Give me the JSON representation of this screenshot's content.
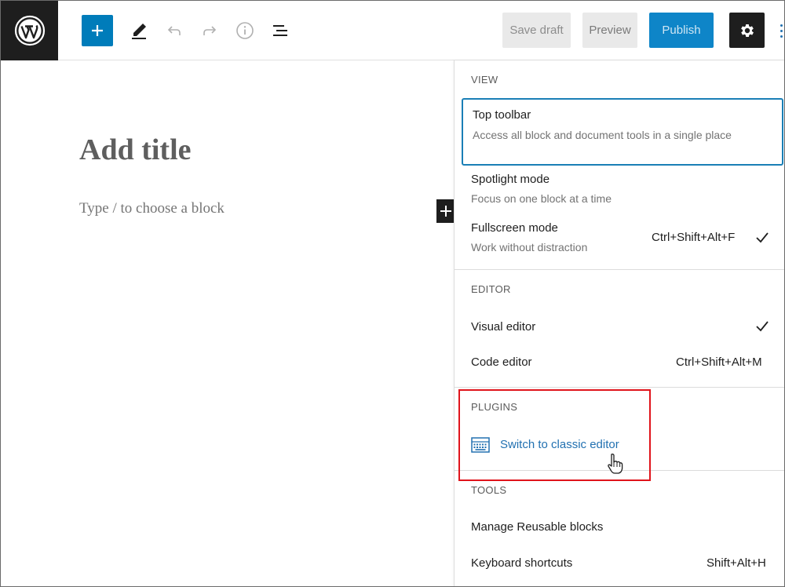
{
  "header": {
    "save_draft_label": "Save draft",
    "preview_label": "Preview",
    "publish_label": "Publish"
  },
  "icons": {
    "wordpress": "wordpress-logo-icon",
    "add": "plus-icon",
    "edit": "pencil-icon",
    "undo": "undo-icon",
    "redo": "redo-icon",
    "info": "info-icon",
    "outline": "list-view-icon",
    "settings": "gear-icon",
    "more": "vertical-ellipsis-icon",
    "plugin": "keyboard-icon",
    "cursor": "hand-pointer-icon",
    "check": "check-icon"
  },
  "editor": {
    "title_placeholder": "Add title",
    "block_placeholder": "Type / to choose a block"
  },
  "menu": {
    "view": {
      "label": "VIEW",
      "items": [
        {
          "label": "Top toolbar",
          "description": "Access all block and document tools in a single place"
        },
        {
          "label": "Spotlight mode",
          "description": "Focus on one block at a time"
        },
        {
          "label": "Fullscreen mode",
          "description": "Work without distraction",
          "shortcut": "Ctrl+Shift+Alt+F",
          "checked": true
        }
      ]
    },
    "editor": {
      "label": "EDITOR",
      "items": [
        {
          "label": "Visual editor",
          "checked": true
        },
        {
          "label": "Code editor",
          "shortcut": "Ctrl+Shift+Alt+M"
        }
      ]
    },
    "plugins": {
      "label": "PLUGINS",
      "items": [
        {
          "label": "Switch to classic editor"
        }
      ]
    },
    "tools": {
      "label": "TOOLS",
      "items": [
        {
          "label": "Manage Reusable blocks"
        },
        {
          "label": "Keyboard shortcuts",
          "shortcut": "Shift+Alt+H"
        }
      ]
    }
  },
  "colors": {
    "accent": "#007cba",
    "publish": "#0e85c8",
    "highlight": "#e0141b",
    "dark": "#1e1e1e"
  }
}
